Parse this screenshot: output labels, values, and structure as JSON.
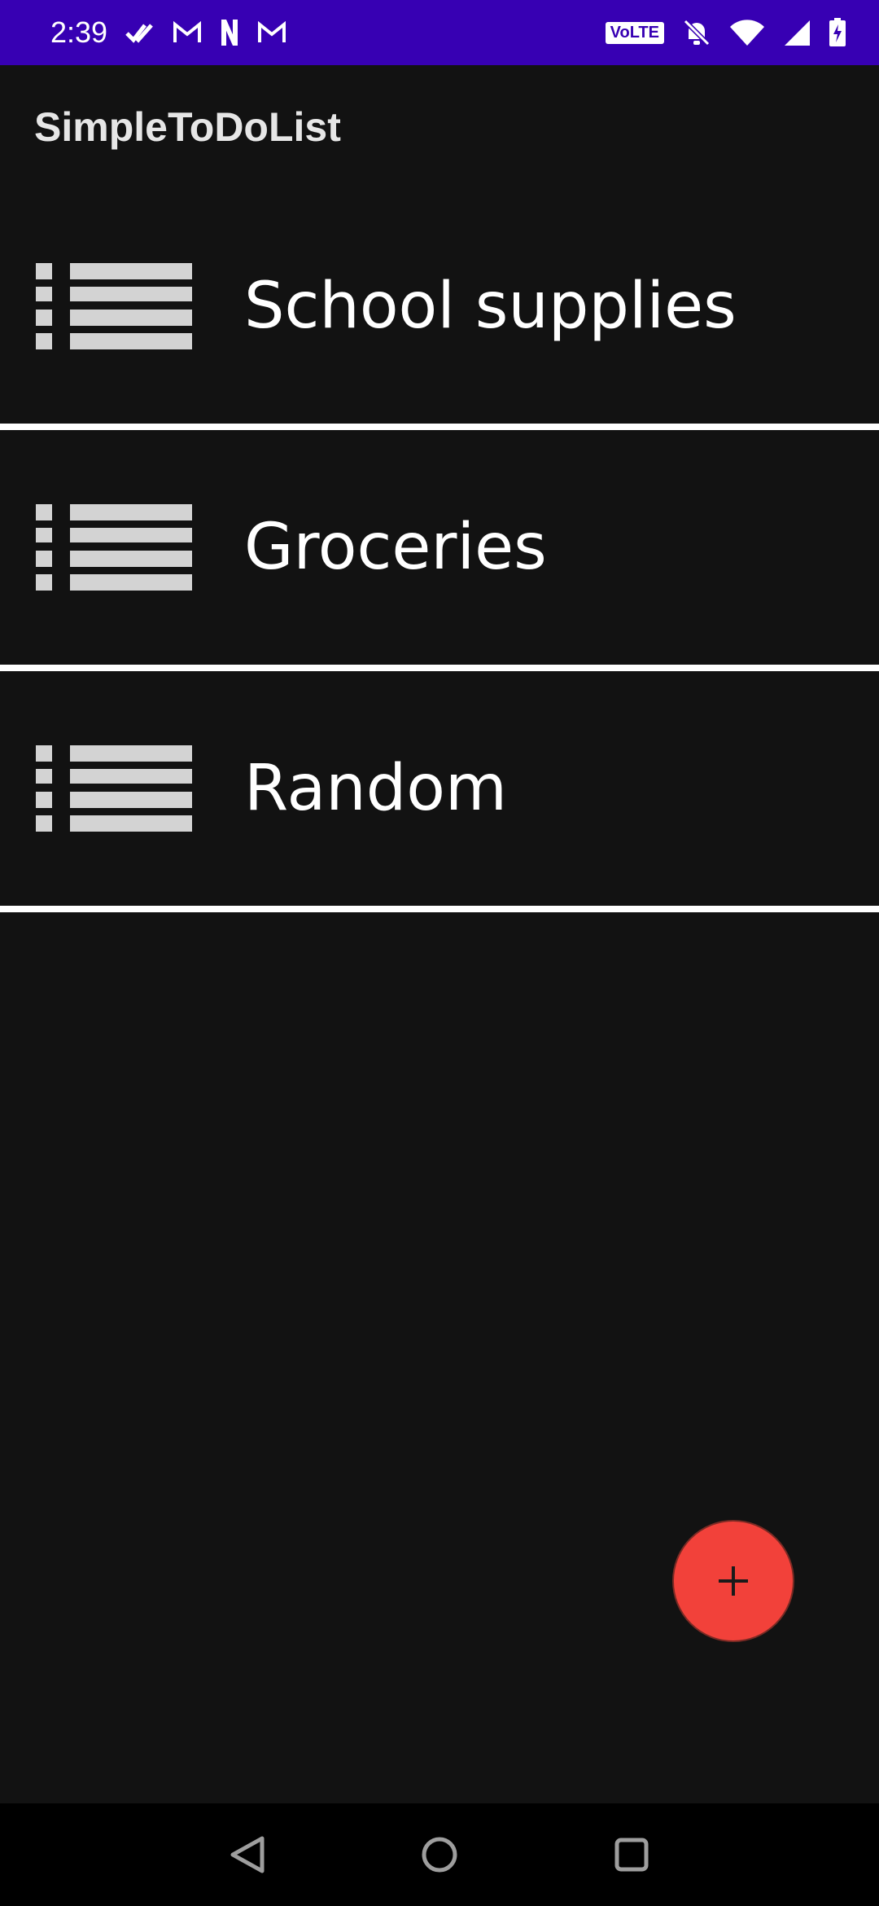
{
  "status_bar": {
    "time": "2:39",
    "left_icons": [
      "check-double-icon",
      "gmail-icon",
      "netflix-icon",
      "gmail-icon"
    ],
    "volte": "VoLTE",
    "right_icons": [
      "volte-icon",
      "bell-off-icon",
      "wifi-icon",
      "signal-icon",
      "battery-charging-icon"
    ],
    "background_color": "#3700b3"
  },
  "app_bar": {
    "title": "SimpleToDoList"
  },
  "lists": [
    {
      "label": "School supplies",
      "icon": "list-icon"
    },
    {
      "label": "Groceries",
      "icon": "list-icon"
    },
    {
      "label": "Random",
      "icon": "list-icon"
    }
  ],
  "fab": {
    "icon": "plus-icon",
    "color": "#f2413a"
  },
  "nav_bar": {
    "buttons": [
      "back-icon",
      "home-icon",
      "recents-icon"
    ]
  }
}
